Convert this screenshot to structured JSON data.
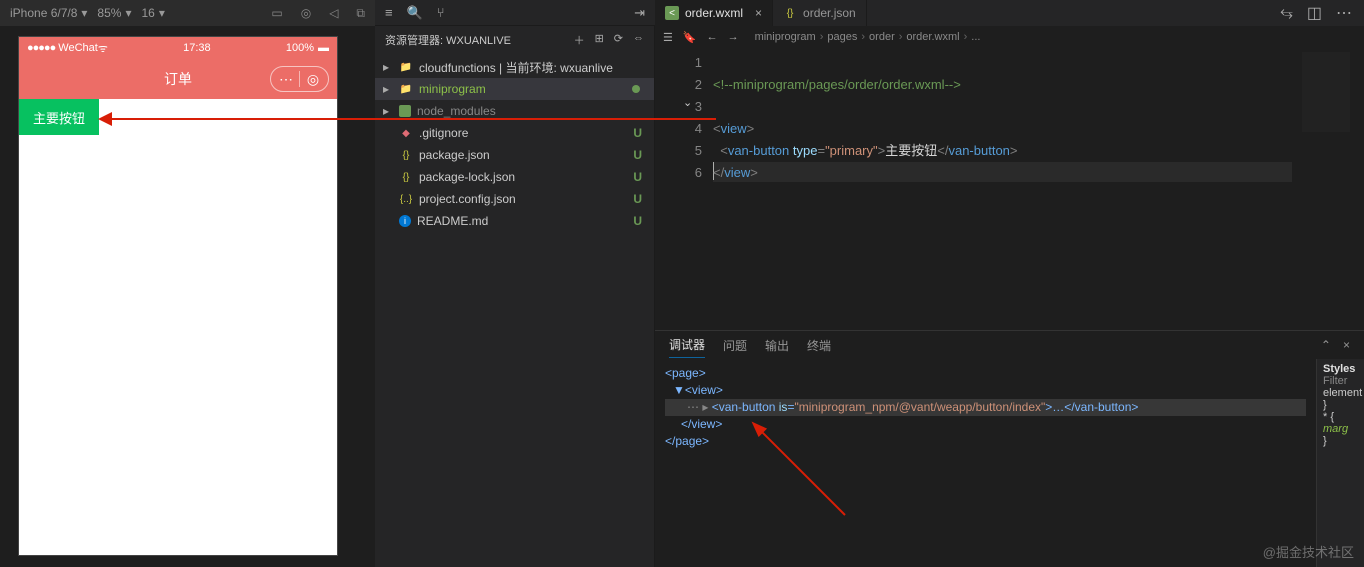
{
  "device_bar": {
    "device": "iPhone 6/7/8",
    "scale": "85%",
    "net": "16"
  },
  "simulator": {
    "carrier": "WeChat",
    "time": "17:38",
    "battery": "100%",
    "title": "订单",
    "button_label": "主要按钮"
  },
  "explorer": {
    "title": "资源管理器: WXUANLIVE",
    "items": [
      {
        "arrow": "▸",
        "icon": "folder",
        "label": "cloudfunctions | 当前环境: wxuanlive",
        "status": "",
        "cls": ""
      },
      {
        "arrow": "▸",
        "icon": "folder-blue",
        "label": "miniprogram",
        "status": "●",
        "cls": "green-txt sel"
      },
      {
        "arrow": "▸",
        "icon": "green-sq",
        "label": "node_modules",
        "status": "",
        "cls": "grey-txt"
      },
      {
        "arrow": "",
        "icon": "git",
        "label": ".gitignore",
        "status": "U",
        "cls": ""
      },
      {
        "arrow": "",
        "icon": "yel",
        "label": "package.json",
        "status": "U",
        "cls": ""
      },
      {
        "arrow": "",
        "icon": "yel",
        "label": "package-lock.json",
        "status": "U",
        "cls": ""
      },
      {
        "arrow": "",
        "icon": "br",
        "label": "project.config.json",
        "status": "U",
        "cls": ""
      },
      {
        "arrow": "",
        "icon": "info",
        "label": "README.md",
        "status": "U",
        "cls": ""
      }
    ]
  },
  "tabs": [
    {
      "icon": "wxml",
      "label": "order.wxml",
      "active": true,
      "close": "×"
    },
    {
      "icon": "json",
      "label": "order.json",
      "active": false,
      "close": ""
    }
  ],
  "breadcrumb": [
    "miniprogram",
    "pages",
    "order",
    "order.wxml",
    "..."
  ],
  "code": {
    "l1_a": "<!--",
    "l1_b": "miniprogram/pages/order/order.wxml",
    "l1_c": "-->",
    "l3": "view",
    "l4_tag": "van-button",
    "l4_attr": "type",
    "l4_val": "\"primary\"",
    "l4_txt": "主要按钮",
    "l5": "view"
  },
  "line_numbers": [
    "1",
    "2",
    "3",
    "4",
    "5",
    "6"
  ],
  "debug_tabs": [
    "调试器",
    "问题",
    "输出",
    "终端"
  ],
  "dom": {
    "l1": "<page>",
    "l2": "<view>",
    "l3_open": "<van-button",
    "l3_attr": "is",
    "l3_val": "\"miniprogram_npm/@vant/weapp/button/index\"",
    "l3_mid": ">…</",
    "l3_close": "van-button>",
    "l4": "</view>",
    "l5": "</page>"
  },
  "styles": {
    "title": "Styles",
    "filter": "Filter",
    "l1": "element",
    "l2": "}",
    "l3": "* {",
    "l4": "marg",
    "l5": "}"
  },
  "watermark": "@掘金技术社区"
}
